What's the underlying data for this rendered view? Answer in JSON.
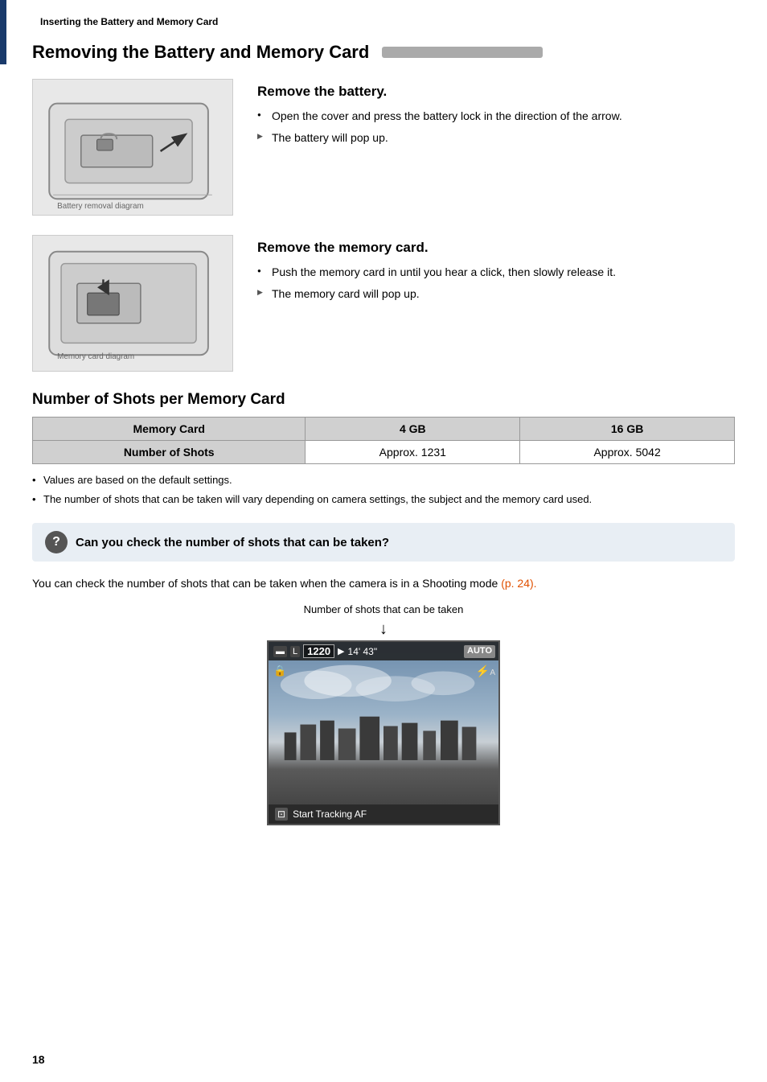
{
  "page": {
    "number": "18",
    "breadcrumb": "Inserting the Battery and Memory Card"
  },
  "section_removing": {
    "title": "Removing the Battery and Memory Card",
    "battery": {
      "heading": "Remove the battery.",
      "steps": [
        {
          "type": "circle",
          "text": "Open the cover and press the battery lock in the direction of the arrow."
        },
        {
          "type": "arrow",
          "text": "The battery will pop up."
        }
      ]
    },
    "memory": {
      "heading": "Remove the memory card.",
      "steps": [
        {
          "type": "circle",
          "text": "Push the memory card in until you hear a click, then slowly release it."
        },
        {
          "type": "arrow",
          "text": "The memory card will pop up."
        }
      ]
    }
  },
  "section_shots": {
    "title": "Number of Shots per Memory Card",
    "table": {
      "headers": [
        "Memory Card",
        "4 GB",
        "16 GB"
      ],
      "rows": [
        [
          "Number of Shots",
          "Approx. 1231",
          "Approx. 5042"
        ]
      ]
    },
    "notes": [
      "Values are based on the default settings.",
      "The number of shots that can be taken will vary depending on camera settings, the subject and the memory card used."
    ]
  },
  "tip_box": {
    "icon": "?",
    "text": "Can you check the number of shots that can be taken?"
  },
  "body_text": "You can check the number of shots that can be taken when the camera is in a Shooting mode",
  "link_text": "(p. 24).",
  "camera_screen": {
    "label": "Number of shots that can be taken",
    "top_icons": [
      "77",
      "L",
      "1220",
      "m",
      "14' 43\""
    ],
    "auto_label": "AUTO",
    "flash_label": "⚡A",
    "lock_icon": "🔒",
    "shots_value": "1220",
    "bottom_text": "Start Tracking AF"
  }
}
